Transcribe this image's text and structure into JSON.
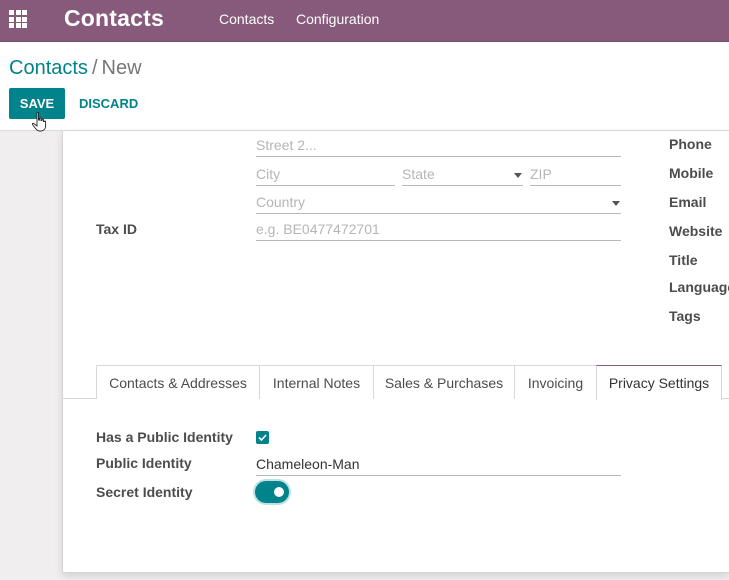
{
  "navbar": {
    "apps_icon": "apps-grid-icon",
    "app_title": "Contacts",
    "menu": [
      "Contacts",
      "Configuration"
    ]
  },
  "breadcrumb": {
    "parent": "Contacts",
    "separator": "/",
    "current": "New"
  },
  "actions": {
    "save": "SAVE",
    "discard": "DISCARD"
  },
  "address": {
    "street2_placeholder": "Street 2...",
    "city_placeholder": "City",
    "state_placeholder": "State",
    "zip_placeholder": "ZIP",
    "country_placeholder": "Country"
  },
  "tax_id": {
    "label": "Tax ID",
    "placeholder": "e.g. BE0477472701"
  },
  "right_labels": [
    "Phone",
    "Mobile",
    "Email",
    "Website",
    "Title",
    "Language",
    "Tags"
  ],
  "tabs": [
    "Contacts & Addresses",
    "Internal Notes",
    "Sales & Purchases",
    "Invoicing",
    "Privacy Settings"
  ],
  "active_tab": "Privacy Settings",
  "privacy": {
    "has_public_identity_label": "Has a Public Identity",
    "has_public_identity": true,
    "public_identity_label": "Public Identity",
    "public_identity_value": "Chameleon-Man",
    "secret_identity_label": "Secret Identity",
    "secret_identity": true
  },
  "colors": {
    "navbar": "#875a7b",
    "accent": "#00838a"
  }
}
